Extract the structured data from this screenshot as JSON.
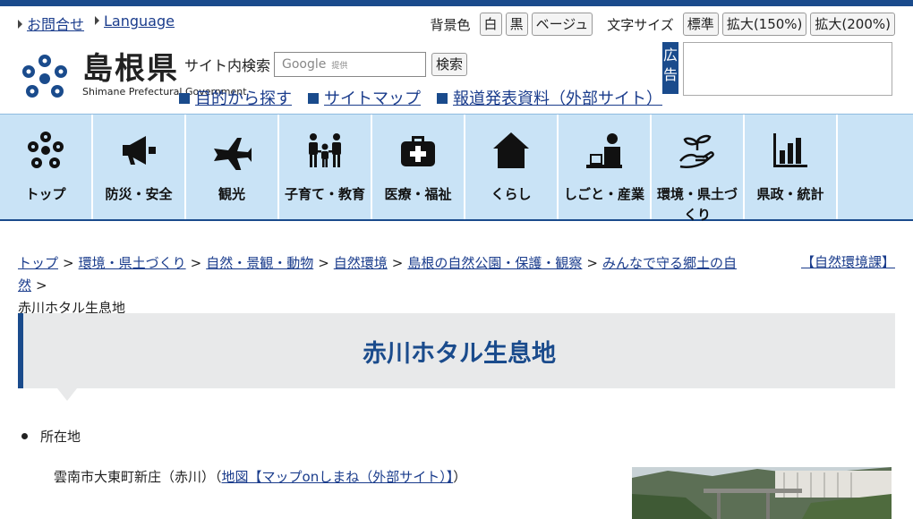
{
  "util": {
    "contact": "お問合せ",
    "language": "Language",
    "bg_label": "背景色",
    "bg_options": [
      "白",
      "黒",
      "ベージュ"
    ],
    "font_label": "文字サイズ",
    "font_options": [
      "標準",
      "拡大(150%)",
      "拡大(200%)"
    ]
  },
  "logo": {
    "jp": "島根県",
    "en": "Shimane Prefectural Government"
  },
  "search": {
    "label": "サイト内検索",
    "placeholder": "Google",
    "provided": "提供",
    "button": "検索"
  },
  "sublinks": [
    "目的から探す",
    "サイトマップ",
    "報道発表資料（外部サイト）"
  ],
  "ad": {
    "tag": "広告"
  },
  "gnav": [
    {
      "label": "トップ",
      "icon": "network-icon"
    },
    {
      "label": "防災・安全",
      "icon": "megaphone-icon"
    },
    {
      "label": "観光",
      "icon": "airplane-icon"
    },
    {
      "label": "子育て・教育",
      "icon": "family-icon"
    },
    {
      "label": "医療・福祉",
      "icon": "medical-bag-icon"
    },
    {
      "label": "くらし",
      "icon": "house-icon"
    },
    {
      "label": "しごと・産業",
      "icon": "worker-laptop-icon"
    },
    {
      "label": "環境・県土づくり",
      "icon": "sprout-hand-icon"
    },
    {
      "label": "県政・統計",
      "icon": "bar-chart-icon"
    }
  ],
  "breadcrumb": {
    "items": [
      "トップ",
      "環境・県土づくり",
      "自然・景観・動物",
      "自然環境",
      "島根の自然公園・保護・観察",
      "みんなで守る郷土の自然"
    ],
    "current": "赤川ホタル生息地",
    "separator": ">"
  },
  "dept_link": "【自然環境課】",
  "page": {
    "title": "赤川ホタル生息地",
    "location_label": "所在地",
    "address": "雲南市大東町新庄（赤川）（",
    "map_link": "地図【マップonしまね（外部サイト）】",
    "address_close": "）"
  },
  "colors": {
    "brand": "#1a4b8c",
    "nav_bg": "#c9e3f6",
    "title_bg": "#e8e9ea"
  }
}
